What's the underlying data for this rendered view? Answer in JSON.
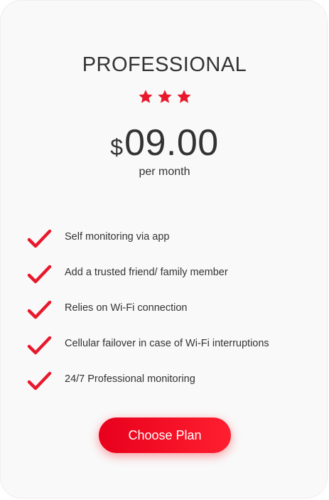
{
  "plan": {
    "title": "PROFESSIONAL",
    "stars": 3,
    "star_icon": "star-icon",
    "price": {
      "currency": "$",
      "amount": "09.00",
      "period": "per month"
    },
    "features": [
      {
        "label": "Self monitoring via app",
        "icon": "checkmark-icon"
      },
      {
        "label": "Add a trusted friend/ family member",
        "icon": "checkmark-icon"
      },
      {
        "label": "Relies on Wi-Fi connection",
        "icon": "checkmark-icon"
      },
      {
        "label": "Cellular failover in case of Wi-Fi interruptions",
        "icon": "checkmark-icon"
      },
      {
        "label": "24/7 Professional monitoring",
        "icon": "checkmark-icon"
      }
    ],
    "cta_label": "Choose Plan"
  },
  "colors": {
    "accent": "#e8192c",
    "text": "#333333",
    "card_background": "#f9f9f9"
  }
}
